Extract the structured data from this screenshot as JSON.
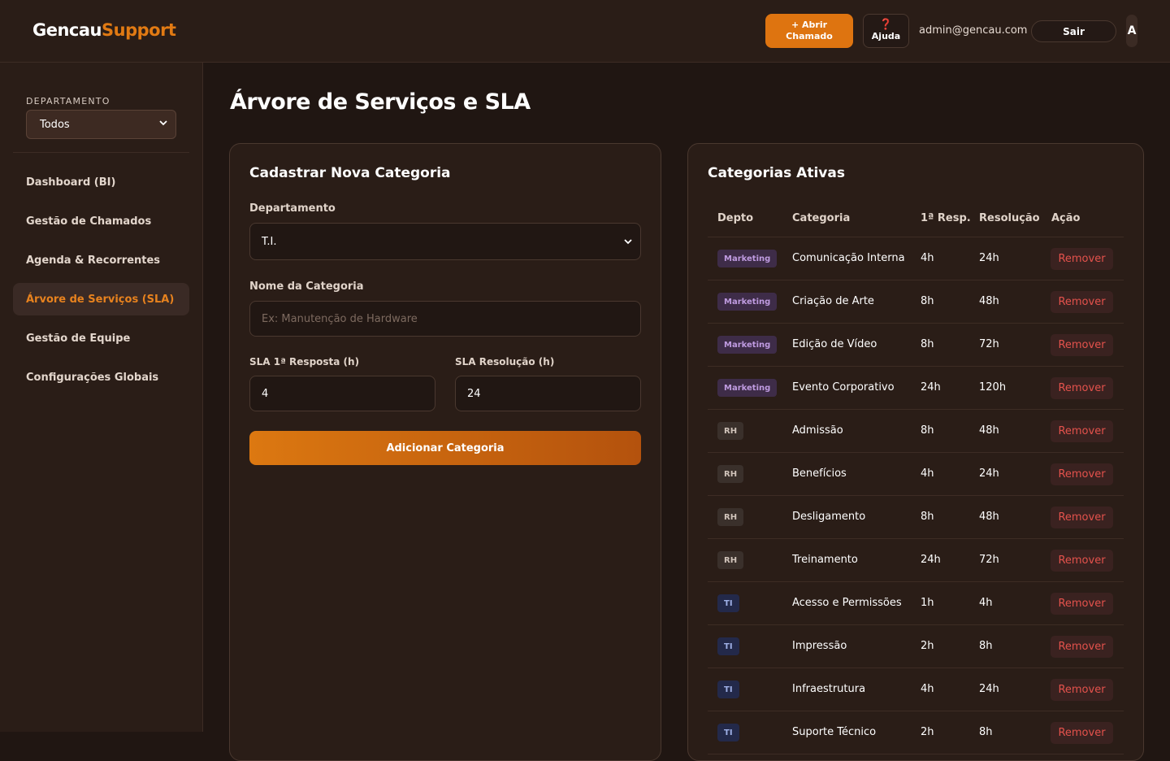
{
  "header": {
    "logo_part1": "Gencau",
    "logo_part2": "Support",
    "open_ticket_line1": "+ Abrir",
    "open_ticket_line2": "Chamado",
    "help_icon": "❓",
    "help_label": "Ajuda",
    "user_email": "admin@gencau.com",
    "logout_label": "Sair",
    "avatar_initial": "A"
  },
  "sidebar": {
    "department_label": "DEPARTAMENTO",
    "department_value": "Todos",
    "items": [
      {
        "label": "Dashboard (BI)"
      },
      {
        "label": "Gestão de Chamados"
      },
      {
        "label": "Agenda & Recorrentes"
      },
      {
        "label": "Árvore de Serviços (SLA)"
      },
      {
        "label": "Gestão de Equipe"
      },
      {
        "label": "Configurações Globais"
      }
    ]
  },
  "main": {
    "title": "Árvore de Serviços e SLA",
    "form": {
      "title": "Cadastrar Nova Categoria",
      "department_label": "Departamento",
      "department_value": "T.I.",
      "name_label": "Nome da Categoria",
      "name_placeholder": "Ex: Manutenção de Hardware",
      "sla_first_label": "SLA 1ª Resposta (h)",
      "sla_first_value": "4",
      "sla_resolution_label": "SLA Resolução (h)",
      "sla_resolution_value": "24",
      "submit_label": "Adicionar Categoria"
    },
    "table": {
      "title": "Categorias Ativas",
      "columns": [
        "Depto",
        "Categoria",
        "1ª Resp.",
        "Resolução",
        "Ação"
      ],
      "remove_label": "Remover",
      "rows": [
        {
          "dept": "Marketing",
          "category": "Comunicação Interna",
          "first": "4h",
          "resolution": "24h"
        },
        {
          "dept": "Marketing",
          "category": "Criação de Arte",
          "first": "8h",
          "resolution": "48h"
        },
        {
          "dept": "Marketing",
          "category": "Edição de Vídeo",
          "first": "8h",
          "resolution": "72h"
        },
        {
          "dept": "Marketing",
          "category": "Evento Corporativo",
          "first": "24h",
          "resolution": "120h"
        },
        {
          "dept": "RH",
          "category": "Admissão",
          "first": "8h",
          "resolution": "48h"
        },
        {
          "dept": "RH",
          "category": "Benefícios",
          "first": "4h",
          "resolution": "24h"
        },
        {
          "dept": "RH",
          "category": "Desligamento",
          "first": "8h",
          "resolution": "48h"
        },
        {
          "dept": "RH",
          "category": "Treinamento",
          "first": "24h",
          "resolution": "72h"
        },
        {
          "dept": "TI",
          "category": "Acesso e Permissões",
          "first": "1h",
          "resolution": "4h"
        },
        {
          "dept": "TI",
          "category": "Impressão",
          "first": "2h",
          "resolution": "8h"
        },
        {
          "dept": "TI",
          "category": "Infraestrutura",
          "first": "4h",
          "resolution": "24h"
        },
        {
          "dept": "TI",
          "category": "Suporte Técnico",
          "first": "2h",
          "resolution": "8h"
        }
      ]
    }
  },
  "colors": {
    "accent": "#de7410",
    "background": "#201612",
    "panel": "#2a1d17",
    "remove_text": "#e4524c"
  }
}
